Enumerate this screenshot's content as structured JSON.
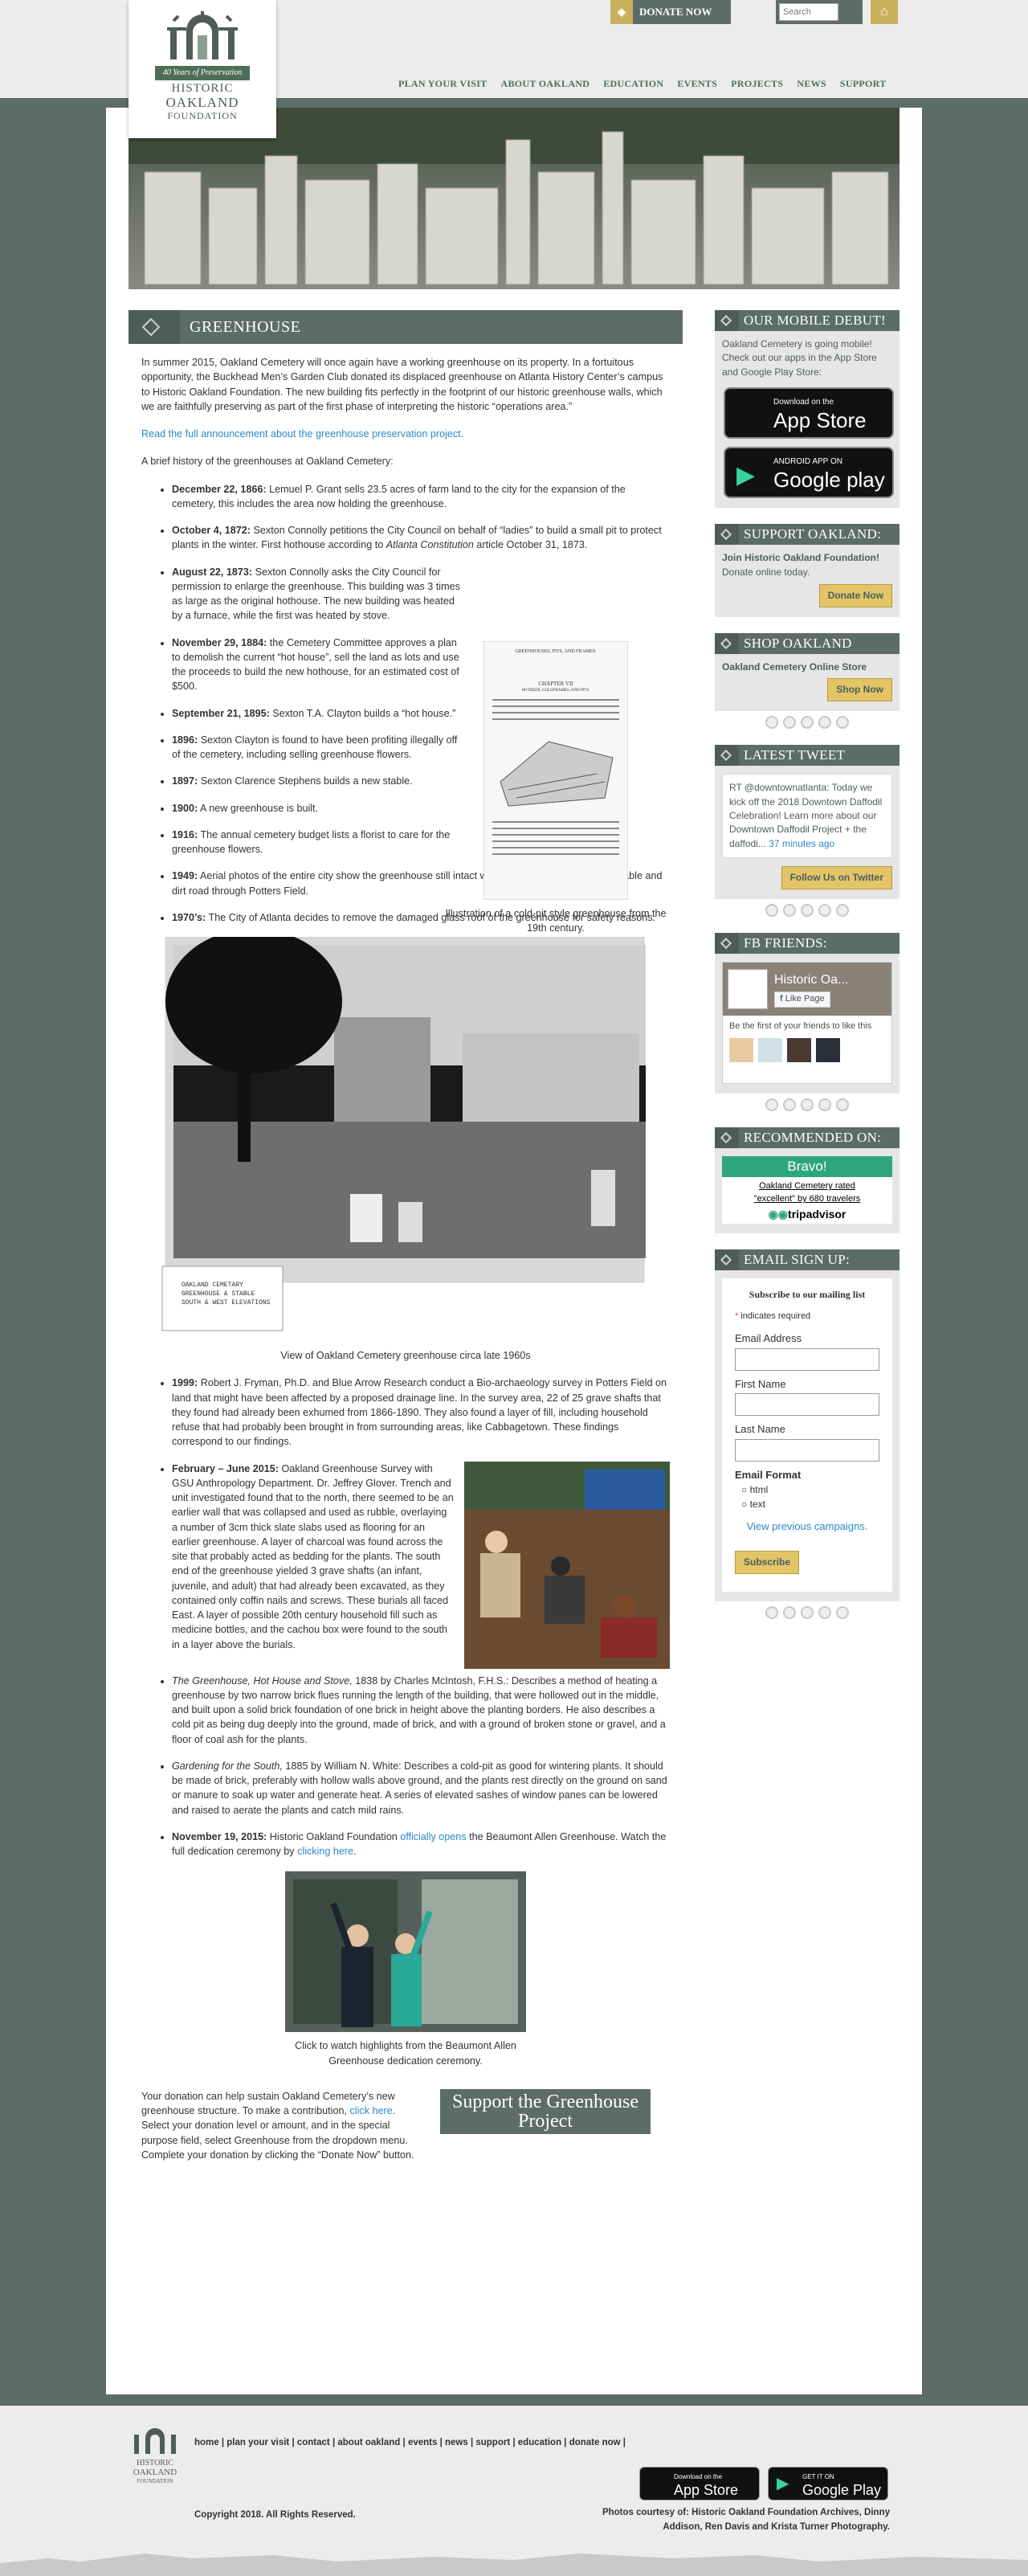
{
  "header": {
    "logo": {
      "line1": "HISTORIC",
      "ribbon": "40 Years of Preservation",
      "line2": "OAKLAND",
      "line3": "FOUNDATION"
    },
    "donate_label": "DONATE NOW",
    "search_placeholder": "Search",
    "nav": [
      "PLAN YOUR VISIT",
      "ABOUT OAKLAND",
      "EDUCATION",
      "EVENTS",
      "PROJECTS",
      "NEWS",
      "SUPPORT"
    ]
  },
  "page": {
    "title": "GREENHOUSE",
    "intro": "In summer 2015, Oakland Cemetery will once again have a working greenhouse on its property. In a fortuitous opportunity, the Buckhead Men’s Garden Club donated its displaced greenhouse on Atlanta History Center’s campus to Historic Oakland Foundation. The new building fits perfectly in the footprint of our historic greenhouse walls, which we are faithfully preserving as part of the first phase of interpreting the historic “operations area.”",
    "announcement_link": "Read the full announcement about the greenhouse preservation project.",
    "brief": "A brief history of the greenhouses at Oakland Cemetery:",
    "history": [
      {
        "date": "December 22, 1866:",
        "text": " Lemuel P. Grant sells 23.5 acres of farm land to the city for the expansion of the cemetery, this includes the area now holding the greenhouse."
      },
      {
        "date": "October 4, 1872:",
        "text": " Sexton Connolly petitions the City Council on behalf of “ladies” to build a small pit to protect plants in the winter. First hothouse according to ",
        "em": "Atlanta Constitution",
        "tail": " article October 31, 1873."
      },
      {
        "date": "August 22, 1873:",
        "text": " Sexton Connolly asks the City Council for permission to enlarge the greenhouse. This building was 3 times as large as the original hothouse. The new building was heated by a furnace, while the first was heated by stove."
      },
      {
        "date": "November 29, 1884:",
        "text": " the Cemetery Committee approves a plan to demolish the current “hot house”, sell the land as lots and use the proceeds to build the new hothouse, for an estimated cost of $500."
      },
      {
        "date": "September 21, 1895:",
        "text": " Sexton T.A. Clayton builds a “hot house.”"
      },
      {
        "date": "1896:",
        "text": " Sexton Clayton is found to have been profiting illegally off of the cemetery, including selling greenhouse flowers."
      },
      {
        "date": "1897:",
        "text": " Sexton Clarence Stephens builds a new stable."
      },
      {
        "date": "1900:",
        "text": " A new greenhouse is built."
      },
      {
        "date": "1916:",
        "text": " The annual cemetery budget lists a florist to care for the greenhouse flowers."
      },
      {
        "date": "1949:",
        "text": " Aerial photos of the entire city show the greenhouse still intact with glass roof, along with the stable and dirt road through Potters Field."
      },
      {
        "date": "1970’s:",
        "text": " The City of Atlanta decides to remove the damaged glass roof of the greenhouse for safety reasons."
      }
    ],
    "fig1_caption": "Illustration of a cold-pit style greenhouse from the 19th century.",
    "fig1_text": {
      "header": "GREENHOUSES, PITS, AND FRAMES.",
      "chapter": "CHAPTER VII",
      "sub": "HOTBEDS, COLDFRAMES, AND PITS."
    },
    "photo1_caption": "View of Oakland Cemetery greenhouse circa late 1960s",
    "photo1_label": "OAKLAND CEMETARY GREENHOUSE & STABLE SOUTH & WEST ELEVATIONS",
    "history2": [
      {
        "date": "1999:",
        "text": " Robert J. Fryman, Ph.D. and Blue Arrow Research conduct a Bio-archaeology survey in Potters Field on land that might have been affected by a proposed drainage line. In the survey area, 22 of 25 grave shafts that they found had already been exhumed from 1866-1890. They also found a layer of fill, including household refuse that had probably been brought in from surrounding areas, like Cabbagetown. These findings correspond to our findings."
      },
      {
        "date": "February – June 2015:",
        "text": " Oakland Greenhouse Survey with GSU Anthropology Department. Dr. Jeffrey Glover. Trench and unit investigated found that to the north, there seemed to be an earlier wall that was collapsed and used as rubble, overlaying a number of 3cm thick slate slabs used as flooring for an earlier greenhouse. A layer of charcoal was found across the site that probably acted as bedding for the plants. The south end of the greenhouse yielded 3 grave shafts (an infant, juvenile, and adult) that had already been excavated, as they contained only coffin nails and screws. These burials all faced East. A layer of possible 20th century household fill such as medicine bottles, and the cachou box were found to the south in a layer above the burials."
      },
      {
        "em": "The Greenhouse, Hot House and Stove,",
        "text": " 1838 by Charles McIntosh, F.H.S.: Describes a method of heating a greenhouse by two narrow brick flues running the length of the building, that were hollowed out in the middle, and built upon a solid brick foundation of one brick in height above the planting borders. He also describes a cold pit as being dug deeply into the ground, made of brick, and with a ground of broken stone or gravel, and a floor of coal ash for the plants."
      },
      {
        "em": "Gardening for the South,",
        "text": " 1885 by William N. White: Describes a cold-pit as good for wintering plants. It should be made of brick, preferably with hollow walls above ground, and the plants rest directly on the ground on sand or manure to soak up water and generate heat. A series of elevated sashes of window panes can be lowered and raised to aerate the plants and catch mild rains."
      }
    ],
    "nov2015": {
      "date": "November 19, 2015:",
      "pre": " Historic Oakland Foundation ",
      "link1": "officially opens",
      "mid": " the Beaumont Allen Greenhouse. Watch the full dedication ceremony by ",
      "link2": "clicking here",
      "end": "."
    },
    "fig3_caption": "Click to watch highlights from the Beaumont Allen Greenhouse dedication ceremony.",
    "donate_p1": "Your donation can help sustain Oakland Cemetery’s new greenhouse structure. To make a contribution, ",
    "donate_link": "click here",
    "donate_p2": ". Select your donation level or amount, and in the special purpose field, select Greenhouse from the dropdown menu. Complete your donation by clicking the “Donate Now” button.",
    "support_button": "Support the Greenhouse Project"
  },
  "sidebar": {
    "mobile": {
      "title": "OUR MOBILE DEBUT!",
      "text": "Oakland Cemetery is going mobile! Check out our apps in the App Store and Google Play Store:",
      "appstore_small": "Download on the",
      "appstore_big": "App Store",
      "gplay_small": "ANDROID APP ON",
      "gplay_big": "Google play"
    },
    "support": {
      "title": "SUPPORT OAKLAND:",
      "bold": "Join Historic Oakland Foundation!",
      "text": " Donate online today.",
      "button": "Donate Now"
    },
    "shop": {
      "title": "SHOP OAKLAND",
      "bold": "Oakland Cemetery Online Store",
      "button": "Shop Now"
    },
    "tweet": {
      "title": "LATEST TWEET",
      "text": "RT @downtownatlanta: Today we kick off the 2018 Downtown Daffodil Celebration! Learn more about our Downtown Daffodil Project + the daffodi...",
      "time": "37 minutes ago",
      "button": "Follow Us on Twitter"
    },
    "fb": {
      "title": "FB FRIENDS:",
      "page_name": "Historic Oa...",
      "like": "Like Page",
      "friends_text": "Be the first of your friends to like this"
    },
    "reco": {
      "title": "RECOMMENDED ON:",
      "bravo": "Bravo!",
      "rated": "Oakland Cemetery rated \"excellent\" by 680 travelers",
      "brand": "tripadvisor"
    },
    "email": {
      "title": "EMAIL SIGN UP:",
      "heading": "Subscribe to our mailing list",
      "required": "indicates required",
      "f_email": "Email Address",
      "f_first": "First Name",
      "f_last": "Last Name",
      "format": "Email Format",
      "opt_html": "html",
      "opt_text": "text",
      "prev": "View previous campaigns.",
      "button": "Subscribe"
    }
  },
  "footer": {
    "links": [
      "home",
      "plan your visit",
      "contact",
      "about oakland",
      "events",
      "news",
      "support",
      "education",
      "donate now"
    ],
    "copyright": "Copyright 2018. All Rights Reserved.",
    "photos": "Photos courtesy of: Historic Oakland Foundation Archives, Dinny Addison, Ren Davis and Krista Turner Photography.",
    "appstore_small": "Download on the",
    "appstore_big": "App Store",
    "gplay_small": "GET IT ON",
    "gplay_big": "Google Play"
  }
}
